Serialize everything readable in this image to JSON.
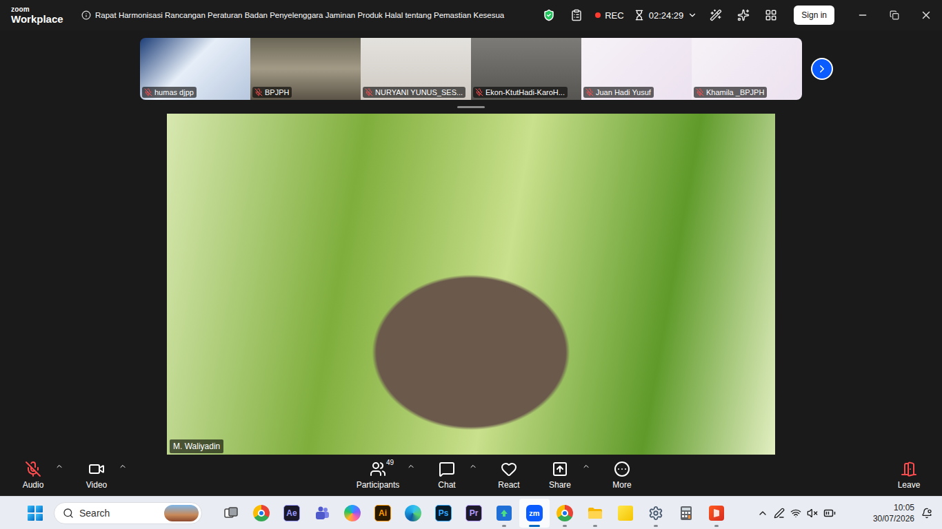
{
  "window": {
    "title": "Rapat Harmonisasi Rancangan Peraturan Badan Penyelenggara Jaminan Produk Halal tentang Pemastian Kesesua"
  },
  "app": {
    "brand": "zoom",
    "product": "Workplace"
  },
  "recording": {
    "label": "REC",
    "on": true
  },
  "timer": "02:24:29",
  "sign_in": "Sign in",
  "gallery": [
    {
      "name": "humas djpp",
      "muted": true
    },
    {
      "name": "BPJPH",
      "muted": true
    },
    {
      "name": "NURYANI YUNUS_SES...",
      "muted": true
    },
    {
      "name": "Ekon-KtutHadi-KaroH...",
      "muted": true
    },
    {
      "name": "Juan Hadi Yusuf",
      "muted": true
    },
    {
      "name": "Khamila _BPJPH",
      "muted": true
    }
  ],
  "speaker": {
    "name": "M. Waliyadin"
  },
  "toolbar": [
    {
      "kind": "audio",
      "label": "Audio",
      "muted": true,
      "menu": true
    },
    {
      "kind": "video",
      "label": "Video",
      "muted": false,
      "menu": true
    },
    {
      "kind": "participants",
      "label": "Participants",
      "count": "49",
      "menu": true
    },
    {
      "kind": "chat",
      "label": "Chat",
      "menu": true
    },
    {
      "kind": "react",
      "label": "React",
      "menu": false
    },
    {
      "kind": "share",
      "label": "Share",
      "menu": true
    },
    {
      "kind": "more",
      "label": "More",
      "menu": false
    },
    {
      "kind": "leave",
      "label": "Leave",
      "menu": false
    }
  ],
  "taskbar": {
    "search": {
      "placeholder": "Search"
    },
    "apps": [
      {
        "kind": "taskview",
        "running": false,
        "active": false
      },
      {
        "kind": "chrome",
        "running": false,
        "active": false
      },
      {
        "kind": "adobe",
        "label": "Ae",
        "color": "#9999ff",
        "running": false,
        "active": false
      },
      {
        "kind": "teams",
        "running": false,
        "active": false
      },
      {
        "kind": "copilot",
        "running": false,
        "active": false
      },
      {
        "kind": "adobe",
        "label": "Ai",
        "color": "#ff9a00",
        "running": false,
        "active": false
      },
      {
        "kind": "edge",
        "running": false,
        "active": false
      },
      {
        "kind": "adobe",
        "label": "Ps",
        "color": "#31a8ff",
        "running": false,
        "active": false
      },
      {
        "kind": "adobe",
        "label": "Pr",
        "color": "#b39cff",
        "running": false,
        "active": false
      },
      {
        "kind": "upload",
        "running": true,
        "active": false
      },
      {
        "kind": "zoom",
        "label": "zm",
        "running": true,
        "active": true
      },
      {
        "kind": "chrome",
        "running": true,
        "active": false
      },
      {
        "kind": "explorer",
        "running": true,
        "active": false
      },
      {
        "kind": "sticky",
        "running": false,
        "active": false
      },
      {
        "kind": "settings",
        "running": true,
        "active": false
      },
      {
        "kind": "calculator",
        "running": false,
        "active": false
      },
      {
        "kind": "office",
        "running": true,
        "active": false
      }
    ],
    "tray": {
      "time": "10:05",
      "date": "30/07/2026"
    }
  }
}
